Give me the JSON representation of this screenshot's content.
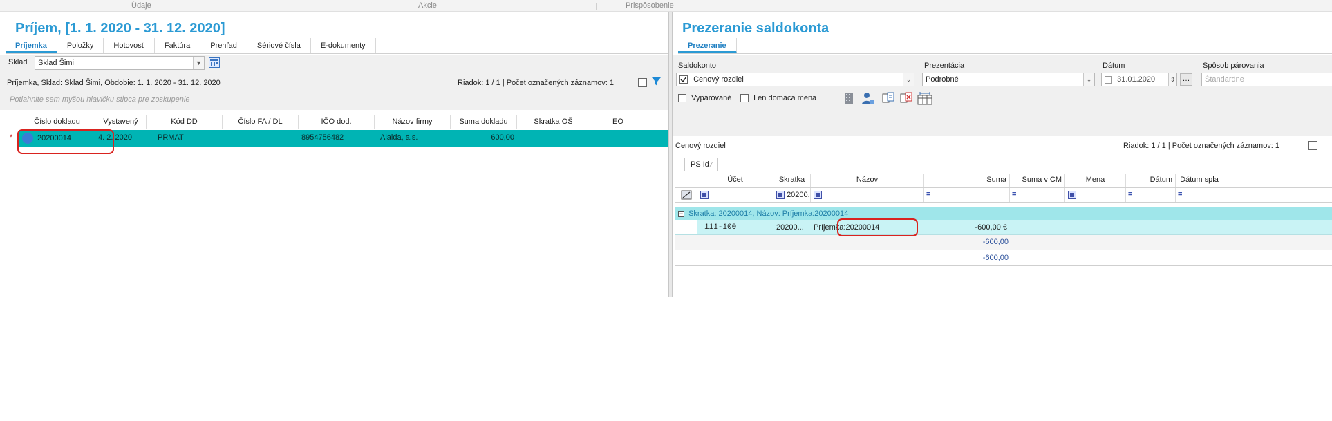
{
  "ribbon": {
    "groups": [
      "Údaje",
      "Akcie",
      "Prispôsobenie"
    ]
  },
  "left": {
    "title": "Príjem,  [1. 1. 2020 - 31. 12. 2020]",
    "tabs": [
      "Príjemka",
      "Položky",
      "Hotovosť",
      "Faktúra",
      "Prehľad",
      "Sériové čísla",
      "E-dokumenty"
    ],
    "sklad_label": "Sklad",
    "sklad_value": "Sklad Šimi",
    "info": "Príjemka, Sklad: Sklad Šimi, Obdobie: 1. 1. 2020 - 31. 12. 2020",
    "riadok": "Riadok: 1 / 1 | Počet označených záznamov: 1",
    "group_hint": "Potiahnite sem myšou hlavičku stĺpca pre zoskupenie",
    "columns": [
      "Číslo dokladu",
      "Vystavený",
      "Kód DD",
      "Číslo FA / DL",
      "IČO dod.",
      "Názov firmy",
      "Suma dokladu",
      "Skratka OŠ",
      "EO"
    ],
    "row": {
      "marker": "*",
      "cislo": "20200014",
      "vystaveny": "4. 2. 2020",
      "kod": "PRMAT",
      "cislo_fa": "",
      "ico": "8954756482",
      "firma": "Alaida, a.s.",
      "suma": "600,00",
      "skratka": "",
      "eo": ""
    }
  },
  "right": {
    "title": "Prezeranie saldokonta",
    "tab": "Prezeranie",
    "saldokonto_label": "Saldokonto",
    "saldokonto_value": "Cenový rozdiel",
    "prezentacia_label": "Prezentácia",
    "prezentacia_value": "Podrobné",
    "datum_label": "Dátum",
    "datum_value": "31.01.2020",
    "sposob_label": "Spôsob párovania",
    "sposob_placeholder": "Štandardne",
    "chk_vyparovane": "Vypárované",
    "chk_domaca": "Len domáca mena",
    "section_label": "Cenový rozdiel",
    "riadok": "Riadok: 1 / 1 | Počet označených záznamov: 1",
    "ps_id": "PS Id",
    "columns": [
      "Účet",
      "Skratka",
      "Názov",
      "Suma",
      "Suma v CM",
      "Mena",
      "Dátum",
      "Dátum spla"
    ],
    "filter_skratka": "20200...",
    "group_row": "Skratka: 20200014, Názov: Príjemka:20200014",
    "data_row": {
      "ucet": "111-100",
      "skratka": "20200...",
      "nazov": "Príjemka:20200014",
      "suma": "-600,00 €"
    },
    "subtotal": "-600,00",
    "total": "-600,00"
  },
  "colors": {
    "accent": "#2b9ad4",
    "selection": "#00b4b4",
    "group_row": "#9fe6ea",
    "highlight_box": "#d9231f"
  }
}
